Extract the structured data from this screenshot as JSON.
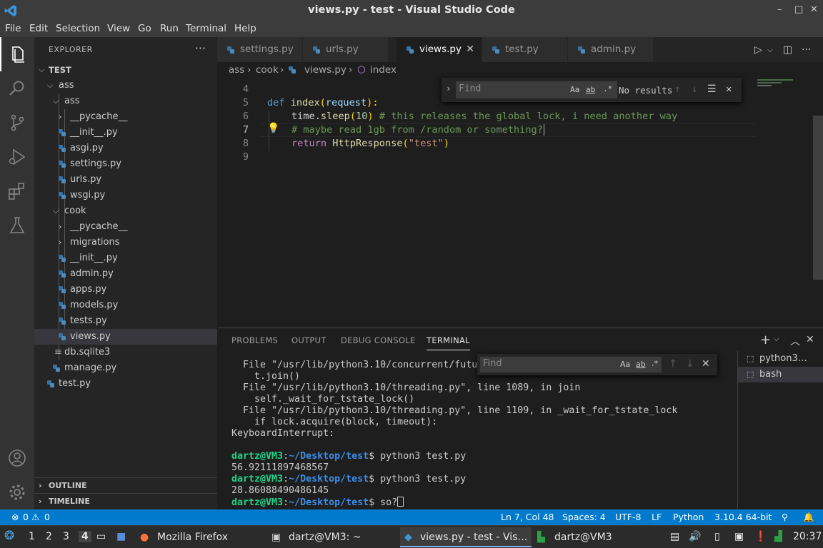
{
  "window": {
    "title": "views.py - test - Visual Studio Code",
    "min": "–",
    "max": "□",
    "close": "✕"
  },
  "menu": [
    "File",
    "Edit",
    "Selection",
    "View",
    "Go",
    "Run",
    "Terminal",
    "Help"
  ],
  "activity": [
    "files-icon",
    "search-icon",
    "source-control-icon",
    "run-debug-icon",
    "extensions-icon",
    "testing-icon",
    "account-icon",
    "settings-gear-icon"
  ],
  "sidebar": {
    "header": "EXPLORER",
    "more": "···",
    "root": "TEST",
    "tree": [
      "ass",
      "ass",
      "__pycache__",
      "__init__.py",
      "asgi.py",
      "settings.py",
      "urls.py",
      "wsgi.py",
      "cook",
      "__pycache__",
      "migrations",
      "__init__.py",
      "admin.py",
      "apps.py",
      "models.py",
      "tests.py",
      "views.py",
      "db.sqlite3",
      "manage.py",
      "test.py"
    ],
    "outline": "OUTLINE",
    "timeline": "TIMELINE"
  },
  "tabs": [
    "settings.py",
    "urls.py",
    "views.py",
    "test.py",
    "admin.py"
  ],
  "breadcrumb": [
    "ass",
    "cook",
    "views.py",
    "index"
  ],
  "editor": {
    "lines": [
      "4",
      "5",
      "6",
      "7",
      "8",
      "9"
    ],
    "code": {
      "l5_def": "def ",
      "l5_fn": "index",
      "l5_open": "(",
      "l5_param": "request",
      "l5_close": "):",
      "l6_a": "time.",
      "l6_fn": "sleep",
      "l6_open": "(",
      "l6_num": "10",
      "l6_close": ")",
      "l6_cm": " # this releases the global lock, i need another way",
      "l7_cm": "# maybe read 1gb from /random or something?",
      "l8_kw": "return ",
      "l8_fn": "HttpResponse",
      "l8_open": "(",
      "l8_str": "\"test\"",
      "l8_close": ")"
    }
  },
  "find_editor": {
    "placeholder": "Find",
    "case": "Aa",
    "word": "ab",
    "regex": ".*",
    "result": "No results"
  },
  "panel": {
    "tabs": [
      "PROBLEMS",
      "OUTPUT",
      "DEBUG CONSOLE",
      "TERMINAL"
    ],
    "terminal_lines": [
      "  File \"/usr/lib/python3.10/concurrent/futu",
      "    t.join()",
      "  File \"/usr/lib/python3.10/threading.py\", line 1089, in join",
      "    self._wait_for_tstate_lock()",
      "  File \"/usr/lib/python3.10/threading.py\", line 1109, in _wait_for_tstate_lock",
      "    if lock.acquire(block, timeout):",
      "KeyboardInterrupt:",
      ""
    ],
    "prompt_user": "dartz@VM3",
    "prompt_sep": ":",
    "prompt_path": "~/Desktop/test",
    "prompt_end": "$ ",
    "cmd1": "python3 test.py",
    "out1": "56.92111897468567",
    "cmd2": "python3 test.py",
    "out2": "28.86088490486145",
    "cmd3": "so?",
    "terminals": [
      "python3…",
      "bash"
    ],
    "find_placeholder": "Find"
  },
  "status": {
    "errors": "0",
    "warnings": "0",
    "position": "Ln 7, Col 48",
    "spaces": "Spaces: 4",
    "encoding": "UTF-8",
    "eol": "LF",
    "language": "Python",
    "interpreter": "3.10.4 64-bit"
  },
  "taskbar": {
    "workspaces": [
      "1",
      "2",
      "3",
      "4"
    ],
    "tasks": [
      "Mozilla Firefox",
      "dartz@VM3: ~",
      "views.py - test - Vis…",
      "dartz@VM3"
    ],
    "clock": "20:37"
  }
}
